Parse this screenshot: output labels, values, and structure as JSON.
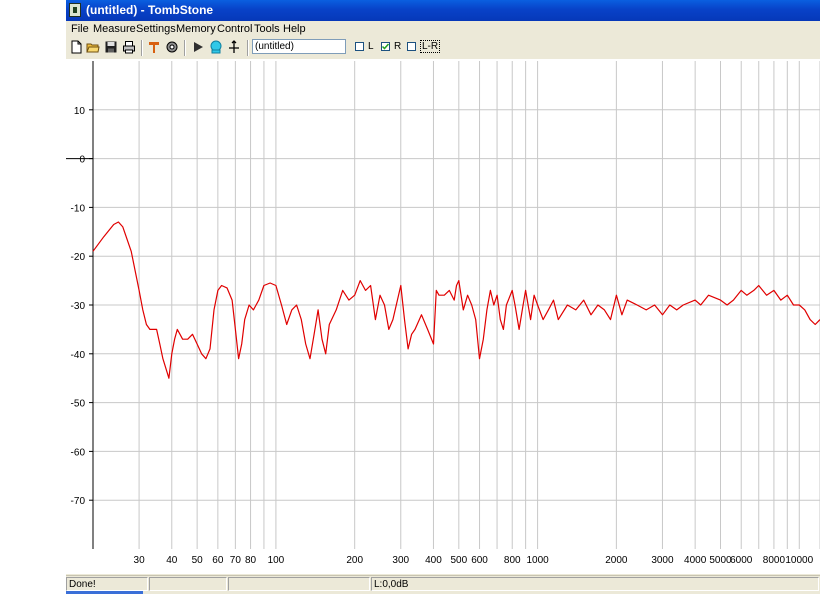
{
  "window": {
    "title": "(untitled) - TombStone"
  },
  "menu": [
    "File",
    "Measure",
    "Settings",
    "Memory",
    "Control",
    "Tools",
    "Help"
  ],
  "toolbar": {
    "icons": [
      "new-file-icon",
      "open-folder-icon",
      "save-disk-icon",
      "print-icon",
      "probe-icon",
      "settings-gear-icon",
      "play-icon",
      "speaker-icon",
      "crosshair-icon"
    ],
    "name_value": "(untitled)",
    "channels": [
      {
        "label": "L",
        "checked": false
      },
      {
        "label": "R",
        "checked": true
      },
      {
        "label": "L-R",
        "checked": false
      }
    ]
  },
  "status": {
    "message": "Done!",
    "panel2": "",
    "level": "L:0,0dB"
  },
  "colors": {
    "trace": "#e00000",
    "grid": "#c8c8c8",
    "title_bar": "#0a5fe0"
  },
  "chart_data": {
    "type": "line",
    "title": "",
    "xlabel": "",
    "ylabel": "",
    "x_scale": "log",
    "xlim": [
      20,
      12000
    ],
    "ylim": [
      -80,
      20
    ],
    "grid": true,
    "y_ticks": [
      10,
      0,
      -10,
      -20,
      -30,
      -40,
      -50,
      -60,
      -70
    ],
    "x_tick_labels": [
      {
        "v": 30,
        "t": "30"
      },
      {
        "v": 40,
        "t": "40"
      },
      {
        "v": 50,
        "t": "50"
      },
      {
        "v": 60,
        "t": "60"
      },
      {
        "v": 70,
        "t": "70"
      },
      {
        "v": 80,
        "t": "80"
      },
      {
        "v": 100,
        "t": "100"
      },
      {
        "v": 200,
        "t": "200"
      },
      {
        "v": 300,
        "t": "300"
      },
      {
        "v": 400,
        "t": "400"
      },
      {
        "v": 500,
        "t": "500"
      },
      {
        "v": 600,
        "t": "600"
      },
      {
        "v": 800,
        "t": "800"
      },
      {
        "v": 1000,
        "t": "1000"
      },
      {
        "v": 2000,
        "t": "2000"
      },
      {
        "v": 3000,
        "t": "3000"
      },
      {
        "v": 4000,
        "t": "4000"
      },
      {
        "v": 5000,
        "t": "5000"
      },
      {
        "v": 6000,
        "t": "6000"
      },
      {
        "v": 8000,
        "t": "8000"
      },
      {
        "v": 10000,
        "t": "10000"
      }
    ],
    "x_grid": [
      30,
      40,
      50,
      60,
      70,
      80,
      90,
      100,
      200,
      300,
      400,
      500,
      600,
      700,
      800,
      900,
      1000,
      2000,
      3000,
      4000,
      5000,
      6000,
      7000,
      8000,
      9000,
      10000,
      12000
    ],
    "series": [
      {
        "color": "#e00000",
        "points": [
          [
            20,
            -19
          ],
          [
            22,
            -16
          ],
          [
            24,
            -13.5
          ],
          [
            25,
            -13
          ],
          [
            26,
            -14
          ],
          [
            28,
            -19
          ],
          [
            30,
            -27
          ],
          [
            31,
            -31
          ],
          [
            32,
            -34
          ],
          [
            33,
            -35
          ],
          [
            35,
            -35
          ],
          [
            36,
            -38
          ],
          [
            37,
            -41
          ],
          [
            39,
            -45
          ],
          [
            40,
            -40
          ],
          [
            41,
            -37
          ],
          [
            42,
            -35
          ],
          [
            43,
            -36
          ],
          [
            44,
            -37
          ],
          [
            46,
            -37
          ],
          [
            48,
            -36
          ],
          [
            50,
            -38
          ],
          [
            52,
            -40
          ],
          [
            54,
            -41
          ],
          [
            56,
            -39
          ],
          [
            58,
            -31
          ],
          [
            60,
            -27
          ],
          [
            62,
            -26
          ],
          [
            65,
            -26.5
          ],
          [
            68,
            -29
          ],
          [
            70,
            -35
          ],
          [
            72,
            -41
          ],
          [
            74,
            -38
          ],
          [
            76,
            -33
          ],
          [
            79,
            -30
          ],
          [
            82,
            -31
          ],
          [
            86,
            -29
          ],
          [
            90,
            -26
          ],
          [
            95,
            -25.5
          ],
          [
            100,
            -26
          ],
          [
            105,
            -30
          ],
          [
            110,
            -34
          ],
          [
            115,
            -31
          ],
          [
            120,
            -30
          ],
          [
            125,
            -33
          ],
          [
            130,
            -38
          ],
          [
            135,
            -41
          ],
          [
            140,
            -36
          ],
          [
            145,
            -31
          ],
          [
            150,
            -37
          ],
          [
            155,
            -40
          ],
          [
            160,
            -34
          ],
          [
            170,
            -31
          ],
          [
            180,
            -27
          ],
          [
            190,
            -29
          ],
          [
            200,
            -28
          ],
          [
            210,
            -25
          ],
          [
            220,
            -27
          ],
          [
            230,
            -26
          ],
          [
            240,
            -33
          ],
          [
            250,
            -28
          ],
          [
            260,
            -30
          ],
          [
            270,
            -35
          ],
          [
            280,
            -33
          ],
          [
            300,
            -26
          ],
          [
            310,
            -33
          ],
          [
            320,
            -39
          ],
          [
            330,
            -36
          ],
          [
            340,
            -35
          ],
          [
            360,
            -32
          ],
          [
            380,
            -35
          ],
          [
            400,
            -38
          ],
          [
            410,
            -27
          ],
          [
            420,
            -28
          ],
          [
            440,
            -28
          ],
          [
            460,
            -27
          ],
          [
            480,
            -29
          ],
          [
            490,
            -26
          ],
          [
            500,
            -25
          ],
          [
            520,
            -31
          ],
          [
            540,
            -28
          ],
          [
            560,
            -30
          ],
          [
            580,
            -33
          ],
          [
            600,
            -41
          ],
          [
            620,
            -37
          ],
          [
            640,
            -31
          ],
          [
            660,
            -27
          ],
          [
            680,
            -30
          ],
          [
            700,
            -28
          ],
          [
            720,
            -33
          ],
          [
            740,
            -35
          ],
          [
            760,
            -30
          ],
          [
            800,
            -27
          ],
          [
            820,
            -30
          ],
          [
            850,
            -35
          ],
          [
            880,
            -30
          ],
          [
            900,
            -27
          ],
          [
            940,
            -33
          ],
          [
            970,
            -28
          ],
          [
            1000,
            -30
          ],
          [
            1050,
            -33
          ],
          [
            1100,
            -31
          ],
          [
            1150,
            -29
          ],
          [
            1200,
            -33
          ],
          [
            1300,
            -30
          ],
          [
            1400,
            -31
          ],
          [
            1500,
            -29
          ],
          [
            1600,
            -32
          ],
          [
            1700,
            -30
          ],
          [
            1800,
            -31
          ],
          [
            1900,
            -33
          ],
          [
            2000,
            -28
          ],
          [
            2100,
            -32
          ],
          [
            2200,
            -29
          ],
          [
            2400,
            -30
          ],
          [
            2600,
            -31
          ],
          [
            2800,
            -30
          ],
          [
            3000,
            -32
          ],
          [
            3200,
            -30
          ],
          [
            3400,
            -31
          ],
          [
            3600,
            -30
          ],
          [
            4000,
            -29
          ],
          [
            4200,
            -30
          ],
          [
            4500,
            -28
          ],
          [
            5000,
            -29
          ],
          [
            5300,
            -30
          ],
          [
            5600,
            -29
          ],
          [
            6000,
            -27
          ],
          [
            6300,
            -28
          ],
          [
            6700,
            -27
          ],
          [
            7000,
            -26
          ],
          [
            7500,
            -28
          ],
          [
            8000,
            -27
          ],
          [
            8500,
            -29
          ],
          [
            9000,
            -28
          ],
          [
            9500,
            -30
          ],
          [
            10000,
            -30
          ],
          [
            10500,
            -31
          ],
          [
            11000,
            -33
          ],
          [
            11500,
            -34
          ],
          [
            12000,
            -33
          ]
        ]
      }
    ]
  }
}
